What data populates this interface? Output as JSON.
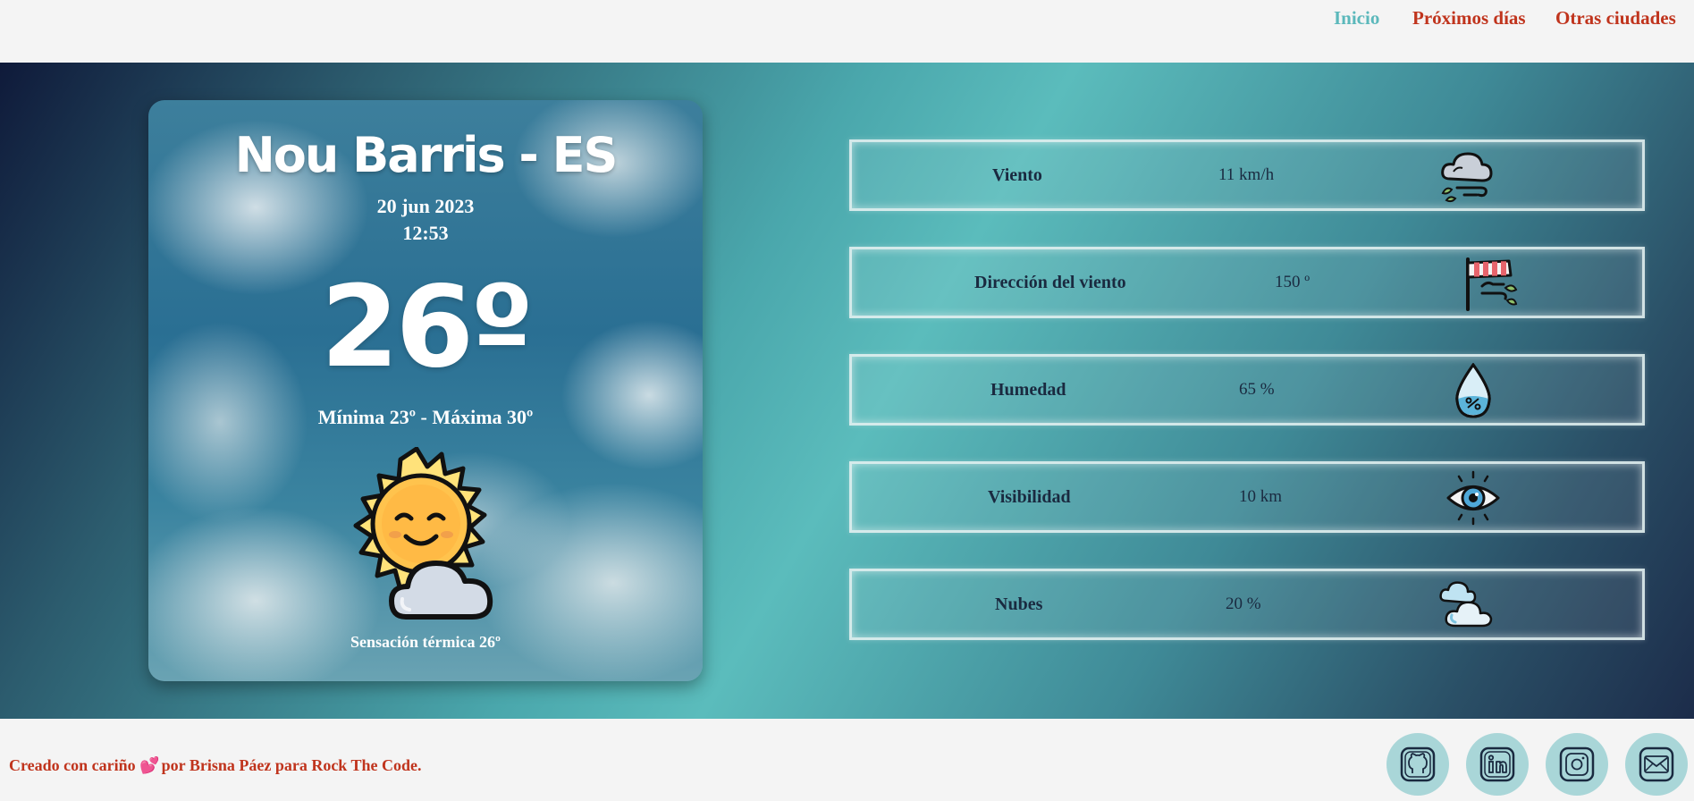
{
  "nav": {
    "items": [
      {
        "label": "Inicio"
      },
      {
        "label": "Próximos días"
      },
      {
        "label": "Otras ciudades"
      }
    ],
    "active_color": "#5bb8bb",
    "link_color": "#c0341d"
  },
  "city": {
    "name": "Nou Barris - ES",
    "date": "20 jun 2023",
    "time": "12:53",
    "temperature": "26º",
    "minmax": "Mínima 23º - Máxima 30º",
    "feels_like": "Sensación térmica 26º",
    "weather_icon": "sun-behind-cloud-icon"
  },
  "stats": [
    {
      "label": "Viento",
      "value": "11 km/h",
      "icon": "wind-cloud-icon"
    },
    {
      "label": "Dirección del viento",
      "value": "150 º",
      "icon": "windsock-icon"
    },
    {
      "label": "Humedad",
      "value": "65 %",
      "icon": "humidity-drop-icon"
    },
    {
      "label": "Visibilidad",
      "value": "10 km",
      "icon": "eye-icon"
    },
    {
      "label": "Nubes",
      "value": "20 %",
      "icon": "clouds-icon"
    }
  ],
  "footer": {
    "credit_prefix": "Creado con cariño",
    "credit_suffix": "por Brisna Páez para Rock The Code.",
    "social": [
      {
        "icon": "github-icon"
      },
      {
        "icon": "linkedin-icon"
      },
      {
        "icon": "instagram-icon"
      },
      {
        "icon": "mail-icon"
      }
    ]
  }
}
